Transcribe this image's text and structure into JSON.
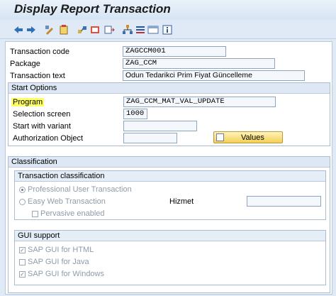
{
  "title": "Display Report Transaction",
  "toolbar": {
    "icons": [
      "back-arrow-icon",
      "forward-arrow-icon",
      "display-change-icon",
      "other-object-icon",
      "where-used-icon",
      "test-icon",
      "object-list-icon",
      "hierarchy-icon",
      "variant-icon",
      "layout-icon",
      "info-icon"
    ]
  },
  "header": {
    "transaction_code_label": "Transaction code",
    "transaction_code": "ZAGCCM001",
    "package_label": "Package",
    "package": "ZAG_CCM",
    "transaction_text_label": "Transaction text",
    "transaction_text": "Odun Tedarikci Prim Fiyat Güncelleme"
  },
  "start_options": {
    "heading": "Start Options",
    "program_label": "Program",
    "program": "ZAG_CCM_MAT_VAL_UPDATE",
    "selection_screen_label": "Selection screen",
    "selection_screen": "1000",
    "start_variant_label": "Start with variant",
    "start_variant": "",
    "auth_object_label": "Authorization Object",
    "auth_object": "",
    "values_button": "Values"
  },
  "classification": {
    "heading": "Classification",
    "transaction_classification": {
      "heading": "Transaction classification",
      "professional": "Professional User Transaction",
      "easy_web": "Easy Web Transaction",
      "pervasive": "Pervasive enabled",
      "service_label": "Hizmet",
      "service": ""
    },
    "gui_support": {
      "heading": "GUI support",
      "html": "SAP GUI for HTML",
      "java": "SAP GUI for Java",
      "windows": "SAP GUI for Windows"
    }
  },
  "colors": {
    "highlight": "#ffff66",
    "button": "#f3cf55"
  }
}
